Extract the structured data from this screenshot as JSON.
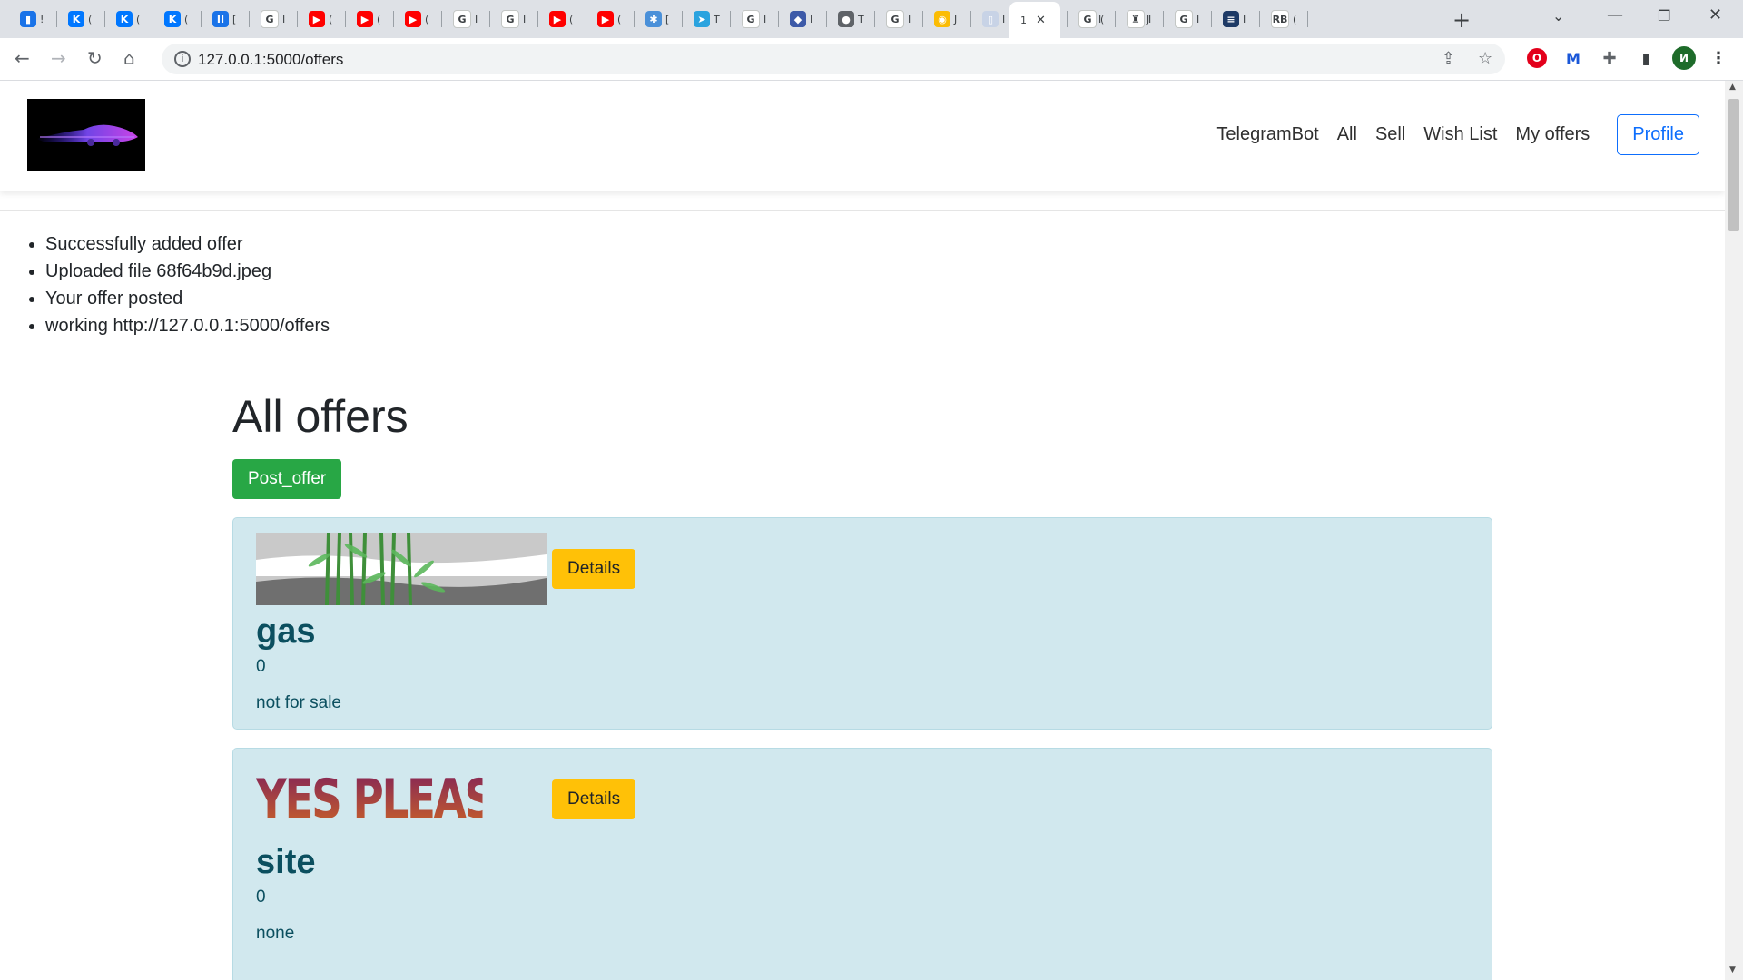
{
  "browser": {
    "tabs": [
      {
        "icon": "chat-icon",
        "color": "#1a73e8",
        "glyph": "▮",
        "char": "!"
      },
      {
        "icon": "vk-icon",
        "color": "#0077ff",
        "glyph": "K",
        "char": "("
      },
      {
        "icon": "vk-icon",
        "color": "#0077ff",
        "glyph": "K",
        "char": "("
      },
      {
        "icon": "vk-icon",
        "color": "#0077ff",
        "glyph": "K",
        "char": "("
      },
      {
        "icon": "pause-icon",
        "color": "#1a73e8",
        "glyph": "II",
        "char": "["
      },
      {
        "icon": "google-icon",
        "color": "#ffffff",
        "glyph": "G",
        "char": "I"
      },
      {
        "icon": "youtube-icon",
        "color": "#ff0000",
        "glyph": "▶",
        "char": "("
      },
      {
        "icon": "youtube-icon",
        "color": "#ff0000",
        "glyph": "▶",
        "char": "("
      },
      {
        "icon": "youtube-icon",
        "color": "#ff0000",
        "glyph": "▶",
        "char": "("
      },
      {
        "icon": "google-icon",
        "color": "#ffffff",
        "glyph": "G",
        "char": "I"
      },
      {
        "icon": "google-icon",
        "color": "#ffffff",
        "glyph": "G",
        "char": "I"
      },
      {
        "icon": "youtube-icon",
        "color": "#ff0000",
        "glyph": "▶",
        "char": "("
      },
      {
        "icon": "youtube-icon",
        "color": "#ff0000",
        "glyph": "▶",
        "char": "("
      },
      {
        "icon": "snowflake-icon",
        "color": "#4a90d9",
        "glyph": "✱",
        "char": "["
      },
      {
        "icon": "telegram-icon",
        "color": "#2aa3df",
        "glyph": "➤",
        "char": "T"
      },
      {
        "icon": "google-icon",
        "color": "#ffffff",
        "glyph": "G",
        "char": "I"
      },
      {
        "icon": "shield-icon",
        "color": "#3d5aa8",
        "glyph": "◆",
        "char": "I"
      },
      {
        "icon": "globe-icon",
        "color": "#5f6368",
        "glyph": "●",
        "char": "T"
      },
      {
        "icon": "google-icon",
        "color": "#ffffff",
        "glyph": "G",
        "char": "I"
      },
      {
        "icon": "chrome-icon",
        "color": "#fbbc04",
        "glyph": "◉",
        "char": "J"
      },
      {
        "icon": "page-icon",
        "color": "#c8d3e6",
        "glyph": "▯",
        "char": "I"
      },
      {
        "icon": "google-icon",
        "color": "#ffffff",
        "glyph": "G",
        "char": "I"
      },
      {
        "icon": "flag-icon",
        "color": "#1d3c78",
        "glyph": "R",
        "char": "I"
      },
      {
        "icon": "map-pin-icon",
        "color": "#ea4335",
        "glyph": "●",
        "char": "J"
      },
      {
        "icon": "google-icon",
        "color": "#ffffff",
        "glyph": "G",
        "char": "I"
      },
      {
        "icon": "doc-icon",
        "color": "#1e3a66",
        "glyph": "≡",
        "char": "I"
      },
      {
        "icon": "rb-icon",
        "color": "#ffffff",
        "glyph": "RB",
        "char": "("
      },
      {
        "icon": "google-icon",
        "color": "#ffffff",
        "glyph": "G",
        "char": "("
      },
      {
        "icon": "figure-icon",
        "color": "#ffffff",
        "glyph": "♜",
        "char": "I"
      }
    ],
    "active_tab": {
      "char": "1"
    },
    "url": "127.0.0.1:5000/offers",
    "profile_initial": "И"
  },
  "site": {
    "nav": {
      "links": [
        "TelegramBot",
        "All",
        "Sell",
        "Wish List",
        "My offers"
      ],
      "profile": "Profile"
    },
    "messages": [
      "Successfully added offer",
      "Uploaded file 68f64b9d.jpeg",
      "Your offer posted",
      "working http://127.0.0.1:5000/offers"
    ],
    "title": "All offers",
    "post_button": "Post_offer",
    "offers": [
      {
        "title": "gas",
        "price": "0",
        "description": "not for sale",
        "details": "Details",
        "image": "bamboo-landscape-image"
      },
      {
        "title": "site",
        "price": "0",
        "description": "none",
        "details": "Details",
        "image": "yes-please-image",
        "image_text": "YES PLEASE!"
      }
    ]
  }
}
